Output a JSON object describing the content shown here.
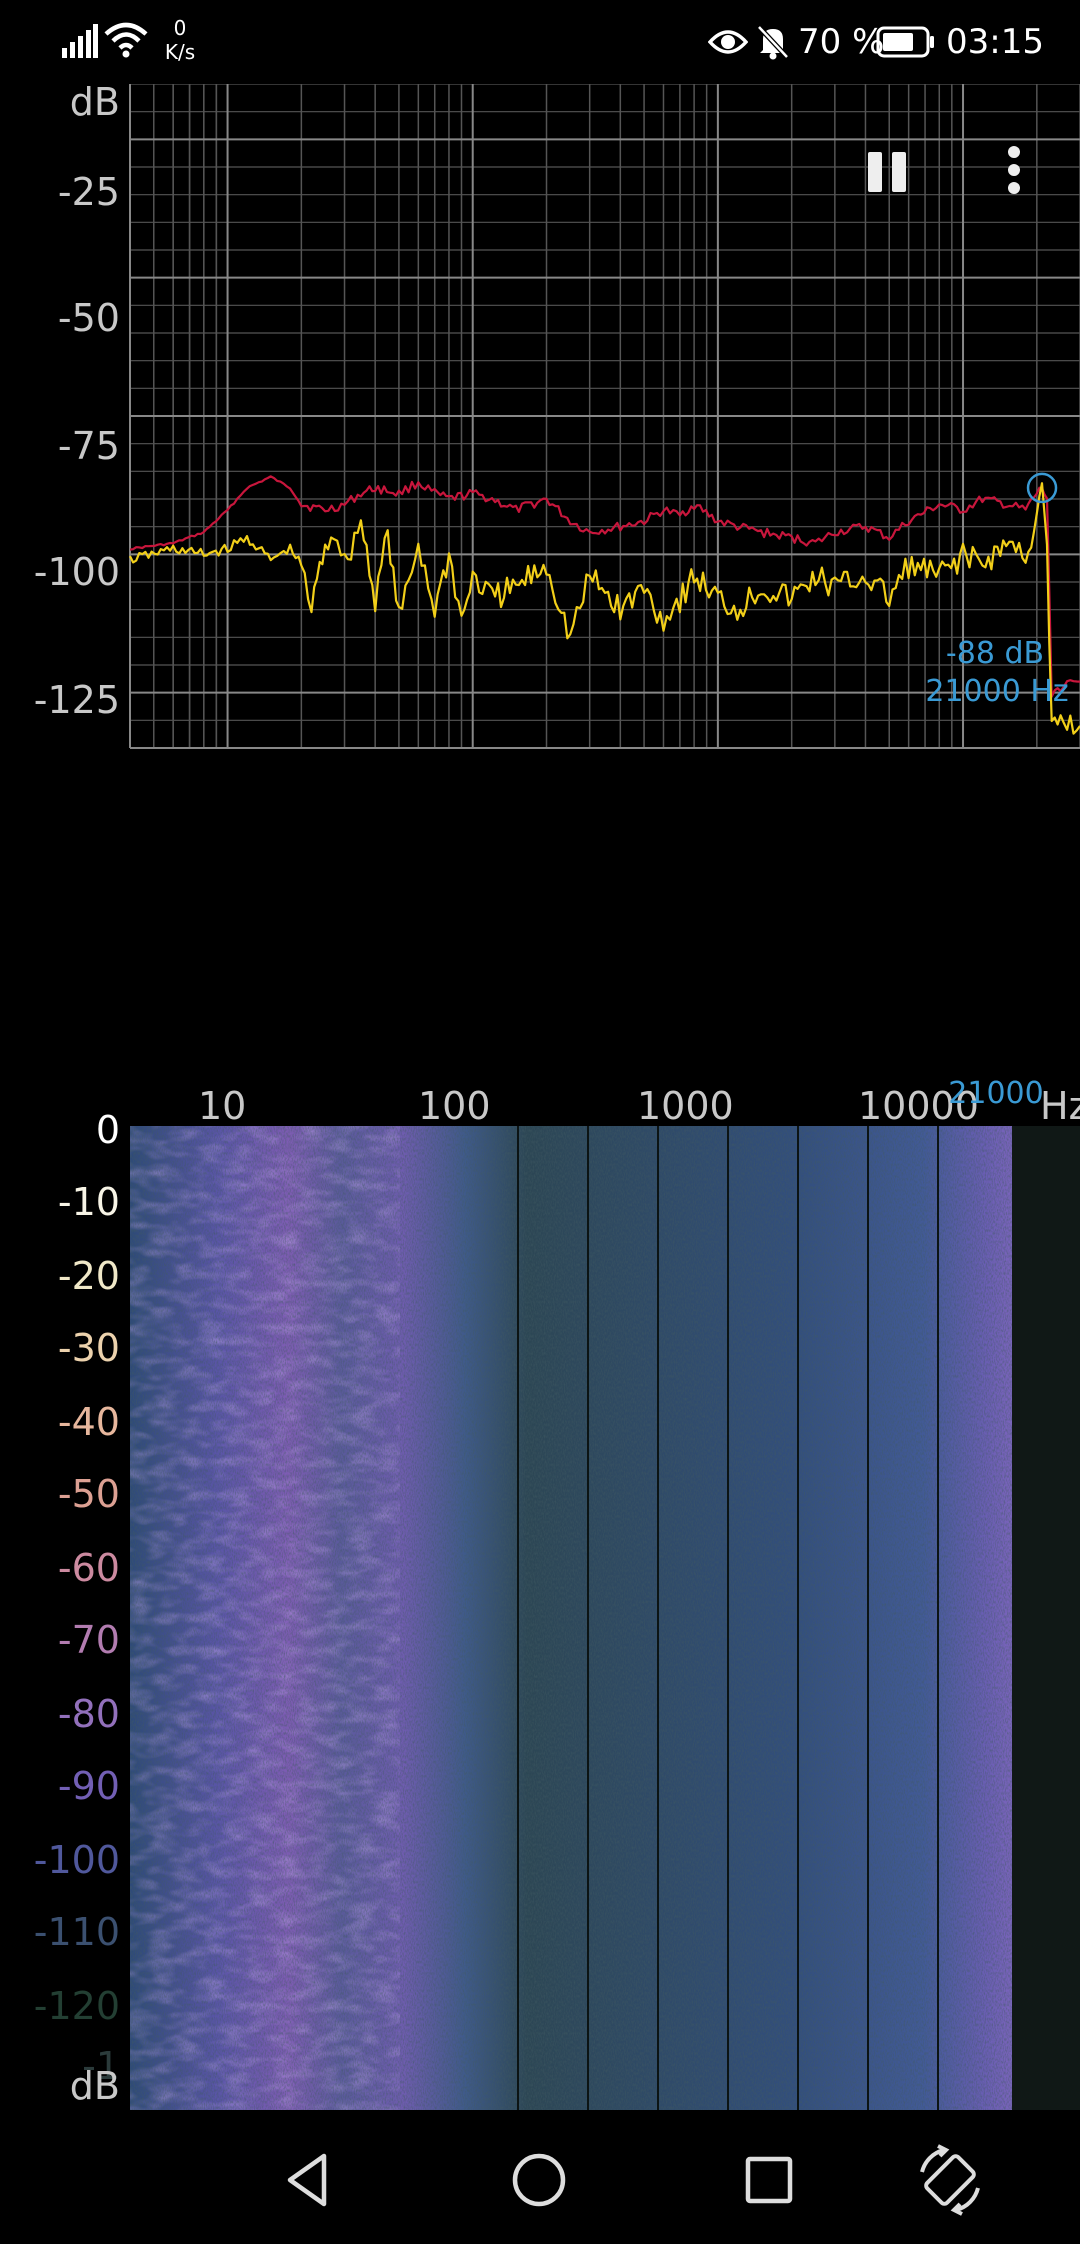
{
  "status_bar": {
    "net_speed_value": "0",
    "net_speed_unit": "K/s",
    "battery_percent": "70 %",
    "time": "03:15",
    "icons": [
      "signal-icon",
      "wifi-icon",
      "eye-icon",
      "bell-muted-icon",
      "battery-icon"
    ]
  },
  "spectrum": {
    "y_unit": "dB",
    "x_unit": "Hz",
    "y_ticks": [
      "-25",
      "-50",
      "-75",
      "-100",
      "-125"
    ],
    "x_ticks": [
      "10",
      "100",
      "1000",
      "10000"
    ],
    "peak": {
      "db_label": "-88 dB",
      "hz_label": "21000 Hz",
      "axis_marker": "21000",
      "frequency_hz": 21000,
      "level_db": -88
    },
    "controls": {
      "pause_icon": "pause-icon",
      "menu_icon": "more-vert-icon"
    },
    "colors": {
      "peak_hold": "#c8163c",
      "current": "#f2cf19",
      "grid": "#555555",
      "peak_marker": "#3a9ad4"
    }
  },
  "chart_data": {
    "type": "line",
    "x_scale": "log",
    "xlim": [
      4,
      30000
    ],
    "ylim": [
      -135,
      -15
    ],
    "xlabel": "Hz",
    "ylabel": "dB",
    "grid": true,
    "series": [
      {
        "color": "#c8163c",
        "x": [
          4,
          6,
          8,
          10,
          12,
          15,
          18,
          20,
          25,
          30,
          35,
          40,
          50,
          60,
          70,
          80,
          100,
          120,
          150,
          200,
          250,
          300,
          400,
          500,
          600,
          700,
          800,
          1000,
          1200,
          1500,
          2000,
          2500,
          3000,
          4000,
          5000,
          6000,
          8000,
          10000,
          12000,
          15000,
          18000,
          20000,
          21000,
          22000,
          23000,
          25000,
          30000
        ],
        "y": [
          -99,
          -98,
          -96,
          -92,
          -88,
          -86,
          -88,
          -91,
          -92,
          -91,
          -89,
          -88,
          -89,
          -87,
          -89,
          -90,
          -89,
          -90,
          -92,
          -90,
          -94,
          -96,
          -95,
          -94,
          -92,
          -93,
          -91,
          -94,
          -95,
          -96,
          -97,
          -98,
          -96,
          -95,
          -97,
          -94,
          -91,
          -92,
          -90,
          -91,
          -92,
          -89,
          -88,
          -90,
          -125,
          -124,
          -123
        ]
      },
      {
        "color": "#f2cf19",
        "x": [
          4,
          6,
          8,
          10,
          12,
          15,
          18,
          20,
          22,
          25,
          28,
          30,
          35,
          40,
          45,
          50,
          60,
          70,
          80,
          90,
          100,
          120,
          150,
          200,
          250,
          300,
          400,
          500,
          600,
          700,
          800,
          1000,
          1200,
          1500,
          2000,
          2500,
          3000,
          4000,
          5000,
          6000,
          8000,
          10000,
          12000,
          15000,
          18000,
          20000,
          21000,
          22000,
          23000,
          25000,
          30000
        ],
        "y": [
          -101,
          -99,
          -100,
          -99,
          -97,
          -101,
          -99,
          -102,
          -110,
          -98,
          -96,
          -102,
          -94,
          -108,
          -96,
          -112,
          -98,
          -110,
          -100,
          -112,
          -104,
          -108,
          -106,
          -102,
          -115,
          -104,
          -110,
          -106,
          -112,
          -108,
          -104,
          -108,
          -110,
          -106,
          -108,
          -104,
          -106,
          -104,
          -108,
          -102,
          -104,
          -100,
          -102,
          -98,
          -100,
          -94,
          -88,
          -100,
          -132,
          -130,
          -131
        ]
      }
    ]
  },
  "spectrogram": {
    "y_ticks": [
      {
        "label": "0",
        "color": "#ffffff"
      },
      {
        "label": "-10",
        "color": "#f7f4e6"
      },
      {
        "label": "-20",
        "color": "#f0e8c8"
      },
      {
        "label": "-30",
        "color": "#ecd2ad"
      },
      {
        "label": "-40",
        "color": "#e7b79d"
      },
      {
        "label": "-50",
        "color": "#dca093"
      },
      {
        "label": "-60",
        "color": "#cc8aa0"
      },
      {
        "label": "-70",
        "color": "#b27cb0"
      },
      {
        "label": "-80",
        "color": "#9270bb"
      },
      {
        "label": "-90",
        "color": "#725fb4"
      },
      {
        "label": "-100",
        "color": "#50589c"
      },
      {
        "label": "-110",
        "color": "#3b5070"
      },
      {
        "label": "-120",
        "color": "#233f33"
      },
      {
        "label": "-1",
        "color": "#2b3b3b"
      }
    ],
    "unit": "dB",
    "colors": {
      "low": "#1b3438",
      "mid": "#3c4f86",
      "high": "#7f5cb2"
    }
  },
  "nav_bar": {
    "icons": [
      "back-icon",
      "home-icon",
      "recents-icon",
      "rotate-icon"
    ]
  }
}
